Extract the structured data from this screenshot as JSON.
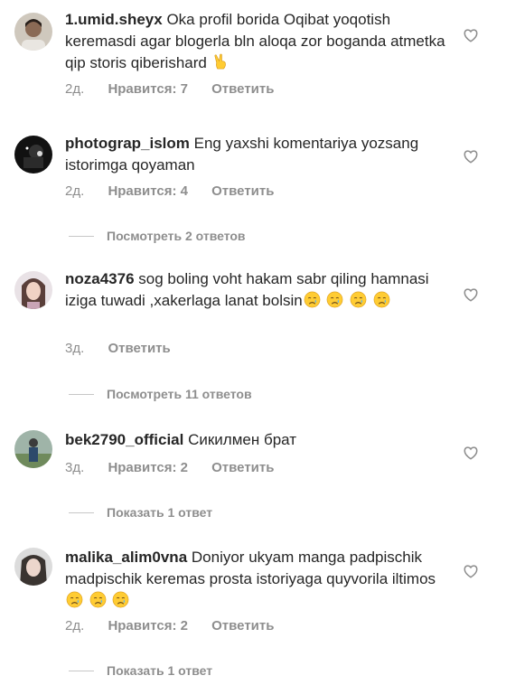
{
  "comments": [
    {
      "username": "1.umid.sheyx",
      "text": "Oka profil borida Oqibat yoqotish keremasdi agar blogerla bln aloqa zor boganda atmetka qip storis qiberishard",
      "emoji": [
        "victory-hand"
      ],
      "time": "2д.",
      "likes": "Нравится: 7",
      "reply": "Ответить"
    },
    {
      "username": "photograp_islom",
      "text": "Eng yaxshi komentariya yozsang istorimga qoyaman",
      "emoji": [],
      "time": "2д.",
      "likes": "Нравится: 4",
      "reply": "Ответить",
      "view_replies": "Посмотреть 2 ответов"
    },
    {
      "username": "noza4376",
      "text": "sog boling voht hakam sabr qiling hamnasi iziga tuwadi ,xakerlaga lanat bolsin",
      "emoji": [
        "crying-face",
        "crying-face",
        "crying-face",
        "crying-face"
      ],
      "time": "3д.",
      "likes": "",
      "reply": "Ответить",
      "view_replies": "Посмотреть 11 ответов"
    },
    {
      "username": "bek2790_official",
      "text": "Сикилмен брат",
      "emoji": [],
      "time": "3д.",
      "likes": "Нравится: 2",
      "reply": "Ответить",
      "view_replies": "Показать 1 ответ"
    },
    {
      "username": "malika_alim0vna",
      "text": "Doniyor ukyam manga padpischik madpischik keremas prosta istoriyaga quyvorila iltimos",
      "emoji": [
        "crying-face",
        "crying-face",
        "crying-face"
      ],
      "time": "2д.",
      "likes": "Нравится: 2",
      "reply": "Ответить",
      "view_replies": "Показать 1 ответ"
    }
  ],
  "icons": {
    "like": "heart-outline-icon"
  },
  "colors": {
    "text": "#262626",
    "meta": "#8e8e8e",
    "divider": "#c7c7c7"
  }
}
